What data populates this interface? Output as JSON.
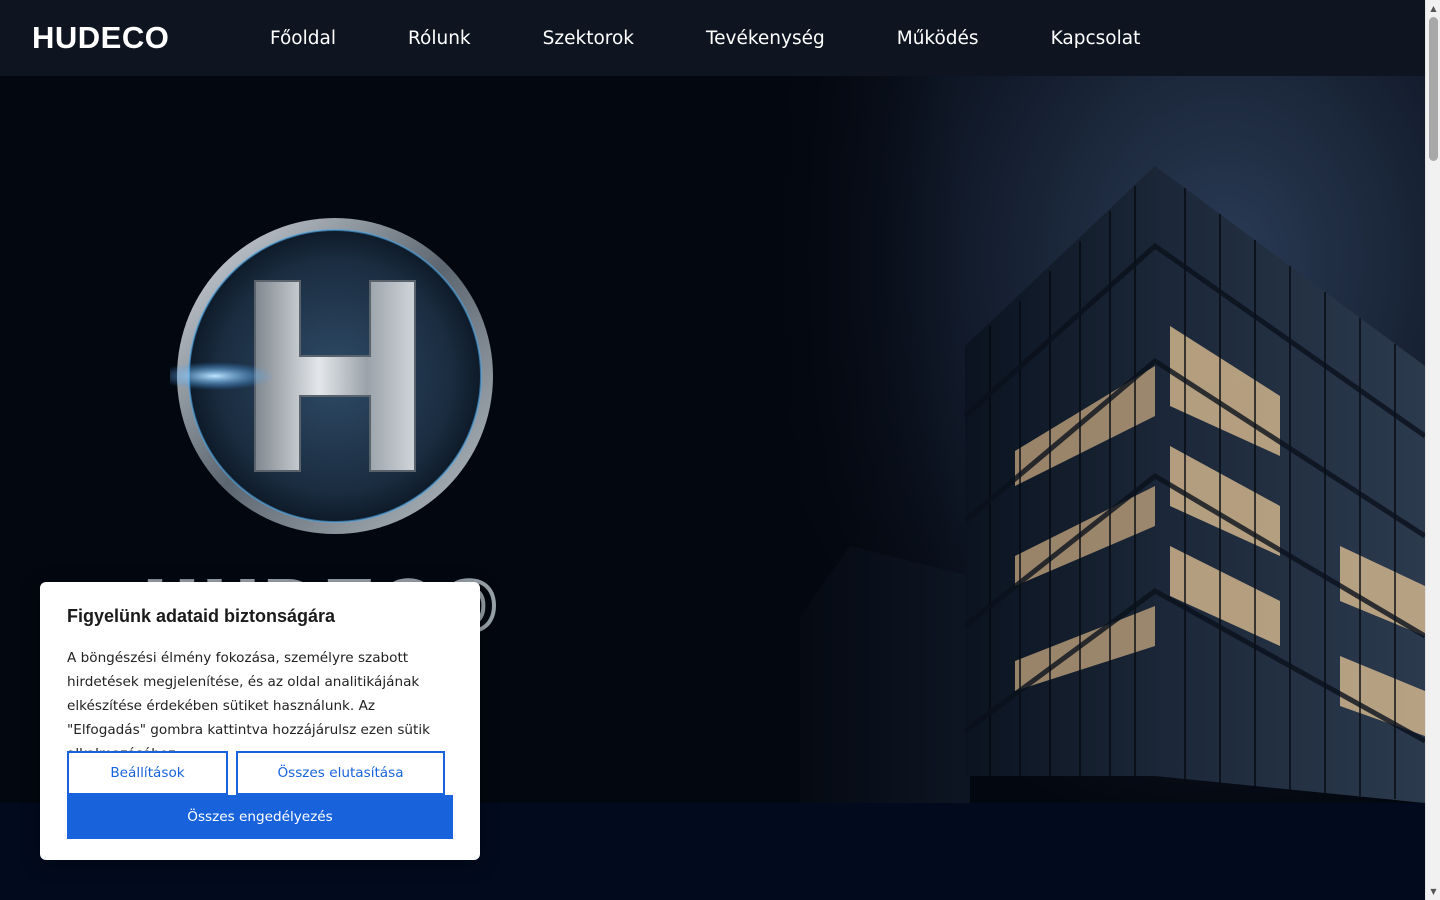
{
  "header": {
    "brand": "HUDECO",
    "nav": [
      {
        "label": "Főoldal"
      },
      {
        "label": "Rólunk"
      },
      {
        "label": "Szektorok"
      },
      {
        "label": "Tevékenység"
      },
      {
        "label": "Működés"
      },
      {
        "label": "Kapcsolat"
      }
    ]
  },
  "hero": {
    "logo_letter": "H",
    "logo_word": "HUDECO"
  },
  "cookie": {
    "title": "Figyelünk adataid biztonságára",
    "text": "A böngészési élmény fokozása, személyre szabott hirdetések megjelenítése, és az oldal analitikájának elkészítése érdekében sütiket használunk. Az \"Elfogadás\" gombra kattintva hozzájárulsz ezen sütik alkalmazásához.",
    "settings_label": "Beállítások",
    "reject_label": "Összes elutasítása",
    "accept_label": "Összes engedélyezés"
  },
  "colors": {
    "header_bg": "#0e1520",
    "hero_bg": "#03070f",
    "accent": "#1863dc"
  }
}
